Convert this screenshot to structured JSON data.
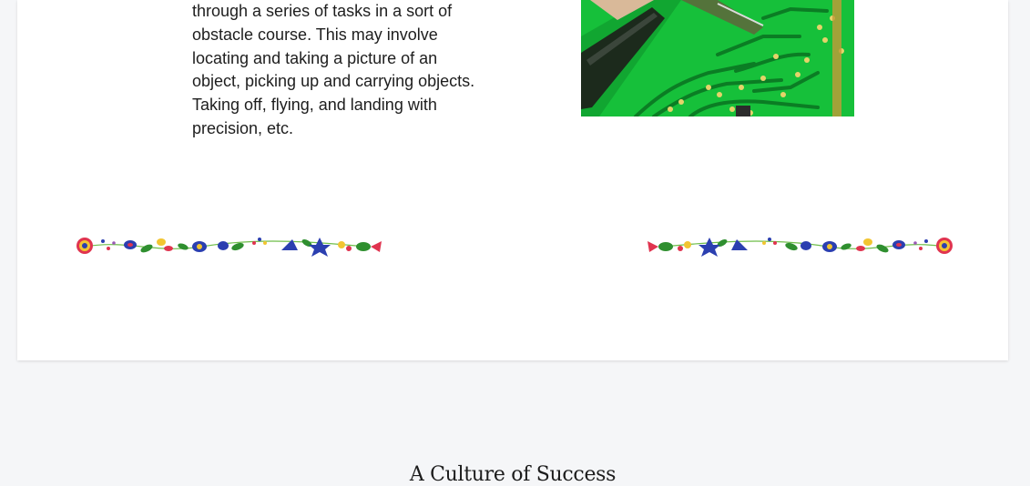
{
  "article": {
    "body_lines": [
      "through a series of tasks in a sort of",
      "obstacle course. This may involve",
      "locating and taking a picture of an",
      "object, picking up and carrying objects.",
      "Taking off, flying, and landing with",
      "precision, etc."
    ],
    "image_subject": "circuit-board-soldering-photo"
  },
  "section": {
    "title": "A Culture of Success"
  },
  "colors": {
    "background": "#f5f6f8",
    "card": "#ffffff",
    "text": "#1e1e1e",
    "board_green": "#17c23a",
    "floral_blue": "#2b3fb0",
    "floral_green": "#2f8f2f",
    "floral_red": "#d6304a",
    "floral_yellow": "#f2c531"
  }
}
